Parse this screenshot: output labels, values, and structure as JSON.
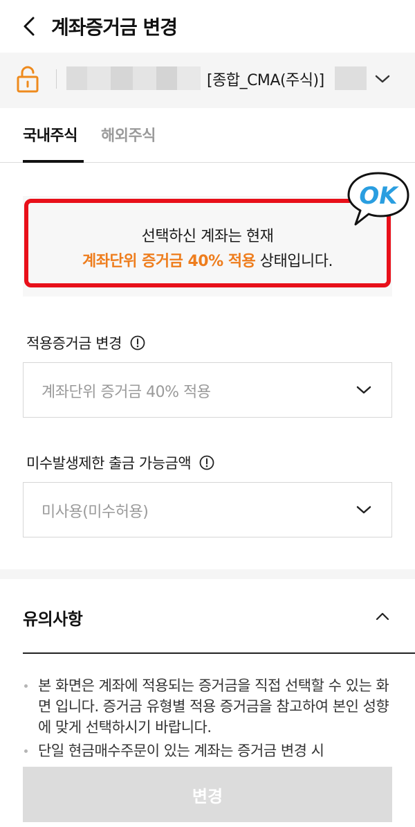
{
  "header": {
    "title": "계좌증거금 변경",
    "back_icon": "chevron-left-icon"
  },
  "account": {
    "lock_icon": "lock-open-icon",
    "account_type": "[종합_CMA(주식)]",
    "dropdown_icon": "chevron-down-icon"
  },
  "tabs": [
    {
      "label": "국내주식",
      "active": true
    },
    {
      "label": "해외주식",
      "active": false
    }
  ],
  "status": {
    "line1": "선택하신 계좌는 현재",
    "highlight": "계좌단위 증거금 40% 적용",
    "line2_suffix": " 상태입니다.",
    "highlight_color": "#ee7d1d",
    "border_color": "#e8101a",
    "sticker_text": "OK",
    "sticker_color": "#2a9ee0"
  },
  "fields": {
    "margin": {
      "label": "적용증거금 변경",
      "value": "계좌단위 증거금 40% 적용"
    },
    "withdraw": {
      "label": "미수발생제한 출금 가능금액",
      "value": "미사용(미수허용)"
    }
  },
  "notice": {
    "title": "유의사항",
    "items": [
      "본 화면은 계좌에 적용되는 증거금을 직접 선택할 수 있는 화면 입니다. 증거금 유형별 적용 증거금을 참고하여 본인 성향에 맞게 선택하시기 바랍니다.",
      "단일 현금매수주문이 있는 계좌는 증거금 변경 시"
    ]
  },
  "submit": {
    "label": "변경"
  }
}
